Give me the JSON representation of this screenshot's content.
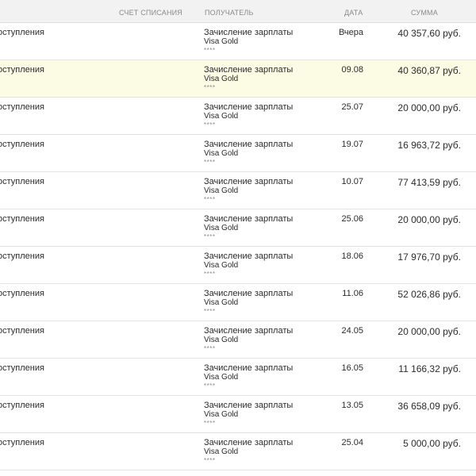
{
  "header": {
    "account_label": "СЧЕТ СПИСАНИЯ",
    "recipient_label": "ПОЛУЧАТЕЛЬ",
    "date_label": "ДАТА",
    "amount_label": "СУММА"
  },
  "transactions": [
    {
      "type": "оступления",
      "type_sub": "",
      "recipient": "Зачисление зарплаты",
      "card": "Visa Gold",
      "mask": "****",
      "date": "Вчера",
      "amount": "40 357,60 руб."
    },
    {
      "type": "оступления",
      "type_sub": "",
      "recipient": "Зачисление зарплаты",
      "card": "Visa Gold",
      "mask": "****",
      "date": "09.08",
      "amount": "40 360,87 руб."
    },
    {
      "type": "оступления",
      "type_sub": "",
      "recipient": "Зачисление зарплаты",
      "card": "Visa Gold",
      "mask": "****",
      "date": "25.07",
      "amount": "20 000,00 руб."
    },
    {
      "type": "оступления",
      "type_sub": "",
      "recipient": "Зачисление зарплаты",
      "card": "Visa Gold",
      "mask": "****",
      "date": "19.07",
      "amount": "16 963,72 руб."
    },
    {
      "type": "оступления",
      "type_sub": "",
      "recipient": "Зачисление зарплаты",
      "card": "Visa Gold",
      "mask": "****",
      "date": "10.07",
      "amount": "77 413,59 руб."
    },
    {
      "type": "оступления",
      "type_sub": "",
      "recipient": "Зачисление зарплаты",
      "card": "Visa Gold",
      "mask": "****",
      "date": "25.06",
      "amount": "20 000,00 руб."
    },
    {
      "type": "оступления",
      "type_sub": "",
      "recipient": "Зачисление зарплаты",
      "card": "Visa Gold",
      "mask": "****",
      "date": "18.06",
      "amount": "17 976,70 руб."
    },
    {
      "type": "оступления",
      "type_sub": "",
      "recipient": "Зачисление зарплаты",
      "card": "Visa Gold",
      "mask": "****",
      "date": "11.06",
      "amount": "52 026,86 руб."
    },
    {
      "type": "оступления",
      "type_sub": "",
      "recipient": "Зачисление зарплаты",
      "card": "Visa Gold",
      "mask": "****",
      "date": "24.05",
      "amount": "20 000,00 руб."
    },
    {
      "type": "оступления",
      "type_sub": "",
      "recipient": "Зачисление зарплаты",
      "card": "Visa Gold",
      "mask": "****",
      "date": "16.05",
      "amount": "11 166,32 руб."
    },
    {
      "type": "оступления",
      "type_sub": "",
      "recipient": "Зачисление зарплаты",
      "card": "Visa Gold",
      "mask": "****",
      "date": "13.05",
      "amount": "36 658,09 руб."
    },
    {
      "type": "оступления",
      "type_sub": "",
      "recipient": "Зачисление зарплаты",
      "card": "Visa Gold",
      "mask": "****",
      "date": "25.04",
      "amount": "5 000,00 руб."
    }
  ]
}
